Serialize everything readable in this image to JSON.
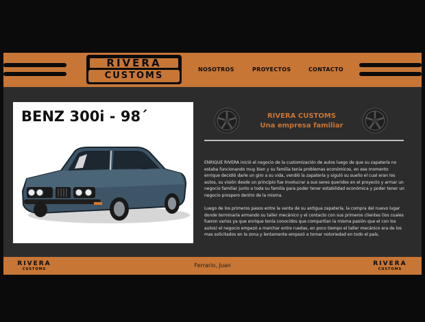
{
  "header": {
    "logo_top": "RIVERA",
    "logo_bottom": "CUSTOMS",
    "nav": [
      "NOSOTROS",
      "PROYECTOS",
      "CONTACTO"
    ]
  },
  "main": {
    "car_title": "BENZ 300i - 98´",
    "brand_name": "RIVERA CUSTOMS",
    "brand_tagline": "Una empresa familiar",
    "paragraphs": [
      "ENRIQUE RIVERA inició el negocio de la customización de autos luego de que su zapatería no estaba funcionando muy bien y su familia tenía problemas económicos, en ese momento enrique decidió darle un giro a su vida, vendió la zapatería y siguió su sueño el cual eran los autos, su visión desde un principio fue involucrar a sus seres queridos en el proyecto y armar un negocio familiar junto a toda su familia para poder tener estabilidad económica y poder tener un negocio prospero dentro de la misma.",
      "Luego de los primeros pasos entre la venta de su antigua zapatería, la compra del nuevo lugar donde terminaría armando su taller mecánico y el contacto con sus primeros clientes (los cuales fueron varios ya que enrique tenía conocidos que compartían la misma pasión que el con los autos) el negocio empezó a marchar entre ruedas, en poco tiempo el taller mecánico era de los mas solicitados en la zona y lentamente empezó a tomar notoriedad en todo el país."
    ]
  },
  "footer": {
    "logo_top": "RIVERA",
    "logo_bottom": "CUSTOMS",
    "author": "Ferrario, Juan"
  },
  "colors": {
    "accent": "#c77636",
    "background": "#0b0b0b",
    "panel": "#2c2c2c"
  },
  "icons": [
    "wheel-rim-icon",
    "car-illustration"
  ]
}
